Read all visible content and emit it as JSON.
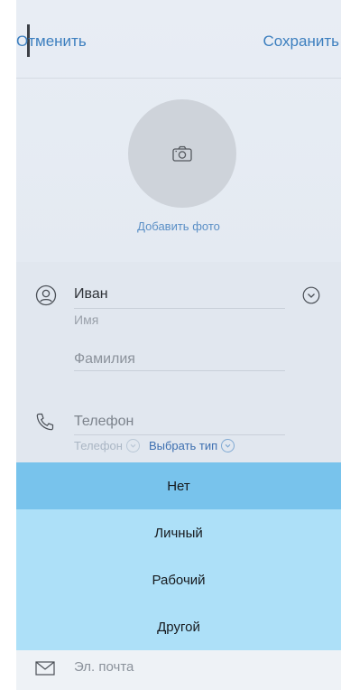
{
  "header": {
    "cancel_label": "Отменить",
    "save_label": "Сохранить"
  },
  "photo": {
    "add_label": "Добавить фото",
    "icon": "camera-icon"
  },
  "name": {
    "first_value": "Иван",
    "first_caption": "Имя",
    "last_placeholder": "Фамилия",
    "icons": {
      "person": "person-icon",
      "expand": "chevron-down-icon"
    }
  },
  "phone": {
    "placeholder": "Телефон",
    "type_placeholder": "Телефон",
    "choose_type_label": "Выбрать тип",
    "icon": "phone-icon"
  },
  "phone_type_dropdown": {
    "options": [
      "Нет",
      "Личный",
      "Рабочий",
      "Другой"
    ],
    "selected": "Нет"
  },
  "email": {
    "placeholder": "Эл. почта",
    "icon": "mail-icon"
  },
  "colors": {
    "accent": "#3d7fbf",
    "dropdown_bg": "#ade0f8",
    "dropdown_selected": "#78c3ec",
    "form_bg": "#e1e7ef"
  }
}
